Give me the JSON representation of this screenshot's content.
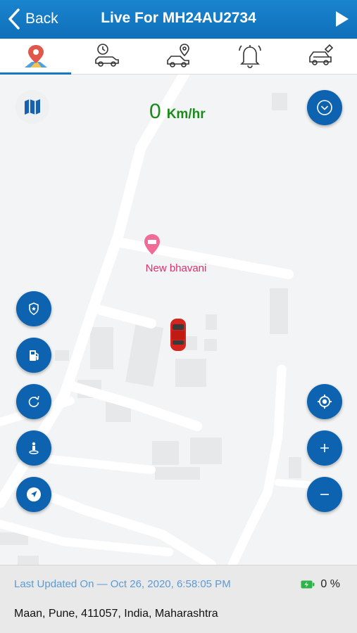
{
  "header": {
    "back_label": "Back",
    "title": "Live For MH24AU2734"
  },
  "tabs": [
    {
      "id": "live",
      "icon": "map-pin-icon",
      "active": true
    },
    {
      "id": "history",
      "icon": "car-clock-icon",
      "active": false
    },
    {
      "id": "geofence",
      "icon": "car-location-icon",
      "active": false
    },
    {
      "id": "alerts",
      "icon": "bell-icon",
      "active": false
    },
    {
      "id": "service",
      "icon": "car-service-icon",
      "active": false
    }
  ],
  "map": {
    "speed_value": "0",
    "speed_unit": "Km/hr",
    "poi_label": "New bhavani",
    "left_buttons": [
      "shield-icon",
      "fuel-pump-icon",
      "refresh-icon",
      "person-pin-icon",
      "navigate-icon"
    ],
    "right_buttons": [
      "chevron-down-icon",
      "locate-icon",
      "zoom-in-icon",
      "zoom-out-icon"
    ]
  },
  "status": {
    "last_updated": "Last Updated On — Oct 26, 2020, 6:58:05 PM",
    "battery": "0 %",
    "address": "Maan, Pune, 411057, India, Maharashtra"
  },
  "colors": {
    "header": "#1a84cf",
    "fab": "#0d63b0",
    "speed": "#1a8b1a",
    "poi": "#e0306a",
    "updated_text": "#5b9bd5"
  }
}
